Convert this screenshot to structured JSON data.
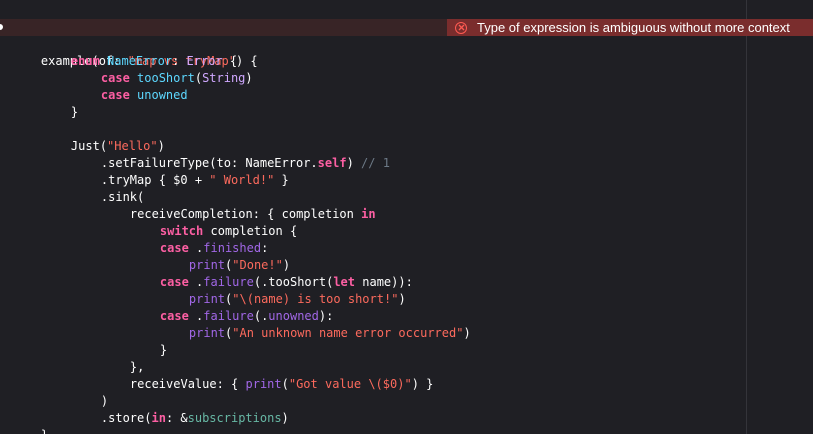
{
  "editor": {
    "error": {
      "message": "Type of expression is ambiguous without more context",
      "icon": "error-x-circle-icon"
    },
    "code": {
      "l1": {
        "a": "example",
        "b": "(of: ",
        "c": "\"map vs tryMap\"",
        "d": ") {"
      },
      "l2": {
        "a": "enum ",
        "b": "NameError",
        "c": ": ",
        "d": "Error",
        "e": " {"
      },
      "l3": {
        "a": "case ",
        "b": "tooShort",
        "c": "(",
        "d": "String",
        "e": ")"
      },
      "l4": {
        "a": "case ",
        "b": "unowned"
      },
      "l5": {
        "a": "}"
      },
      "l6": {
        "a": "Just",
        "b": "(",
        "c": "\"Hello\"",
        "d": ")"
      },
      "l7": {
        "a": ".setFailureType(to: NameError.",
        "b": "self",
        "c": ") ",
        "d": "// 1"
      },
      "l8": {
        "a": ".tryMap { $0 + ",
        "b": "\" World!\"",
        "c": " }"
      },
      "l9": {
        "a": ".sink("
      },
      "l10": {
        "a": "receiveCompletion: { completion ",
        "b": "in"
      },
      "l11": {
        "a": "switch",
        "b": " completion {"
      },
      "l12": {
        "a": "case",
        "b": " .",
        "c": "finished",
        "d": ":"
      },
      "l13": {
        "a": "print",
        "b": "(",
        "c": "\"Done!\"",
        "d": ")"
      },
      "l14": {
        "a": "case",
        "b": " .",
        "c": "failure",
        "d": "(.tooShort(",
        "e": "let",
        "f": " name)):"
      },
      "l15": {
        "a": "print",
        "b": "(",
        "c": "\"\\(name) is too short!\"",
        "d": ")"
      },
      "l16": {
        "a": "case",
        "b": " .",
        "c": "failure",
        "d": "(.",
        "e": "unowned",
        "f": "):"
      },
      "l17": {
        "a": "print",
        "b": "(",
        "c": "\"An unknown name error occurred\"",
        "d": ")"
      },
      "l18": {
        "a": "}"
      },
      "l19": {
        "a": "},"
      },
      "l20": {
        "a": "receiveValue: { ",
        "b": "print",
        "c": "(",
        "d": "\"Got value \\($0)\"",
        "e": ") }"
      },
      "l21": {
        "a": ")"
      },
      "l22": {
        "a": ".store(",
        "b": "in",
        "c": ": &",
        "d": "subscriptions",
        "e": ")"
      },
      "l23": {
        "a": "}"
      }
    }
  }
}
